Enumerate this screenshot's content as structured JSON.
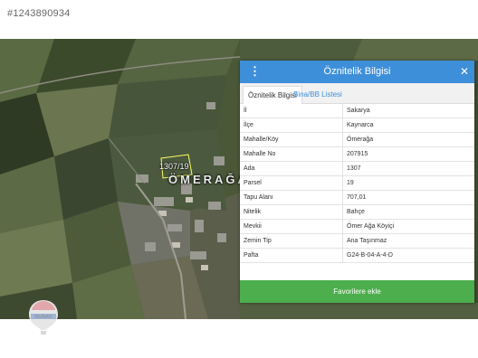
{
  "listing_id": "#1243890934",
  "map": {
    "village_label": "ÖMERAĞA",
    "parcel_label": "1307/19"
  },
  "panel": {
    "title": "Öznitelik Bilgisi",
    "menu_icon": "vertical-dots-icon",
    "close_icon": "close-icon",
    "accent_color": "#3e8fd9",
    "tabs": [
      {
        "label": "Öznitelik Bilgisi",
        "active": true
      },
      {
        "label": "Bina/BB Listesi",
        "active": false
      }
    ],
    "rows": [
      {
        "key": "İl",
        "value": "Sakarya"
      },
      {
        "key": "İlçe",
        "value": "Kaynarca"
      },
      {
        "key": "Mahalle/Köy",
        "value": "Ömerağa"
      },
      {
        "key": "Mahalle No",
        "value": "207915"
      },
      {
        "key": "Ada",
        "value": "1307"
      },
      {
        "key": "Parsel",
        "value": "19"
      },
      {
        "key": "Tapu Alanı",
        "value": "707,01"
      },
      {
        "key": "Nitelik",
        "value": "Bahçe"
      },
      {
        "key": "Mevkii",
        "value": "Ömer Ağa Köyiçi"
      },
      {
        "key": "Zemin Tip",
        "value": "Ana Taşınmaz"
      },
      {
        "key": "Pafta",
        "value": "G24-B-04-A-4-D"
      }
    ],
    "button_label": "Favorilere ekle",
    "button_color": "#4cae4c"
  },
  "logo": {
    "text": "RE/MAX",
    "icon": "remax-balloon-logo"
  }
}
